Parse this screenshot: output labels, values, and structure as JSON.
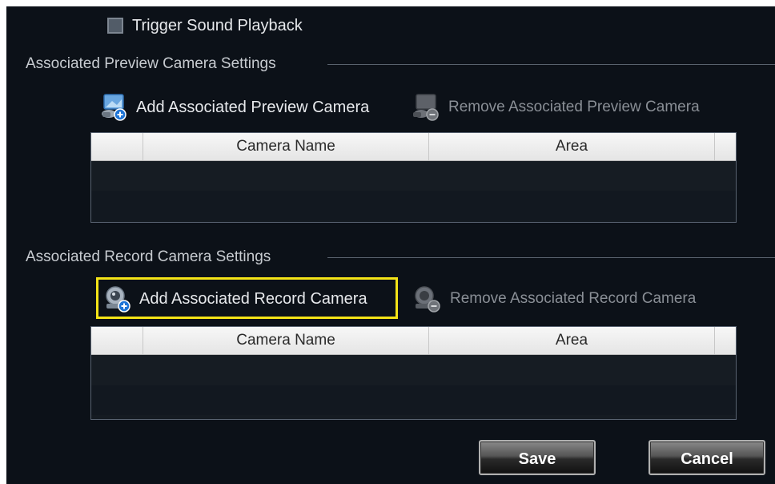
{
  "trigger": {
    "label": "Trigger Sound Playback",
    "checked": false
  },
  "preview_section": {
    "title": "Associated Preview Camera Settings",
    "add_label": "Add Associated Preview Camera",
    "remove_label": "Remove Associated Preview Camera",
    "columns": [
      "Camera Name",
      "Area"
    ]
  },
  "record_section": {
    "title": "Associated Record  Camera Settings",
    "add_label": "Add Associated Record  Camera",
    "remove_label": "Remove Associated Record  Camera",
    "columns": [
      "Camera Name",
      "Area"
    ]
  },
  "buttons": {
    "save": "Save",
    "cancel": "Cancel"
  },
  "colors": {
    "background": "#0c1118",
    "highlight": "#f4e417"
  }
}
